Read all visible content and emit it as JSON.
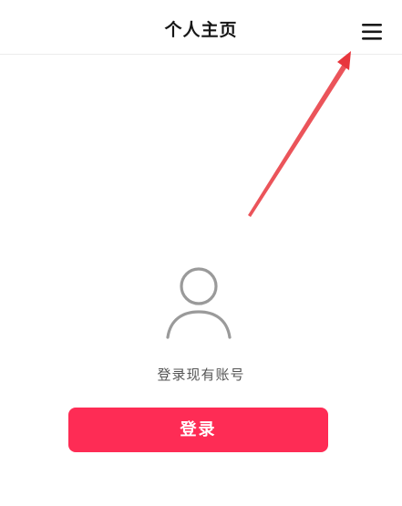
{
  "header": {
    "title": "个人主页",
    "menu_icon": "hamburger-menu-icon"
  },
  "annotation": {
    "type": "arrow",
    "color": "#e8363d"
  },
  "profile": {
    "avatar_icon": "user-silhouette-icon",
    "login_prompt": "登录现有账号",
    "login_button_label": "登录"
  },
  "colors": {
    "primary": "#fe2c55",
    "title_text": "#161616",
    "secondary_text": "#555555",
    "icon_gray": "#9a9a9a"
  }
}
